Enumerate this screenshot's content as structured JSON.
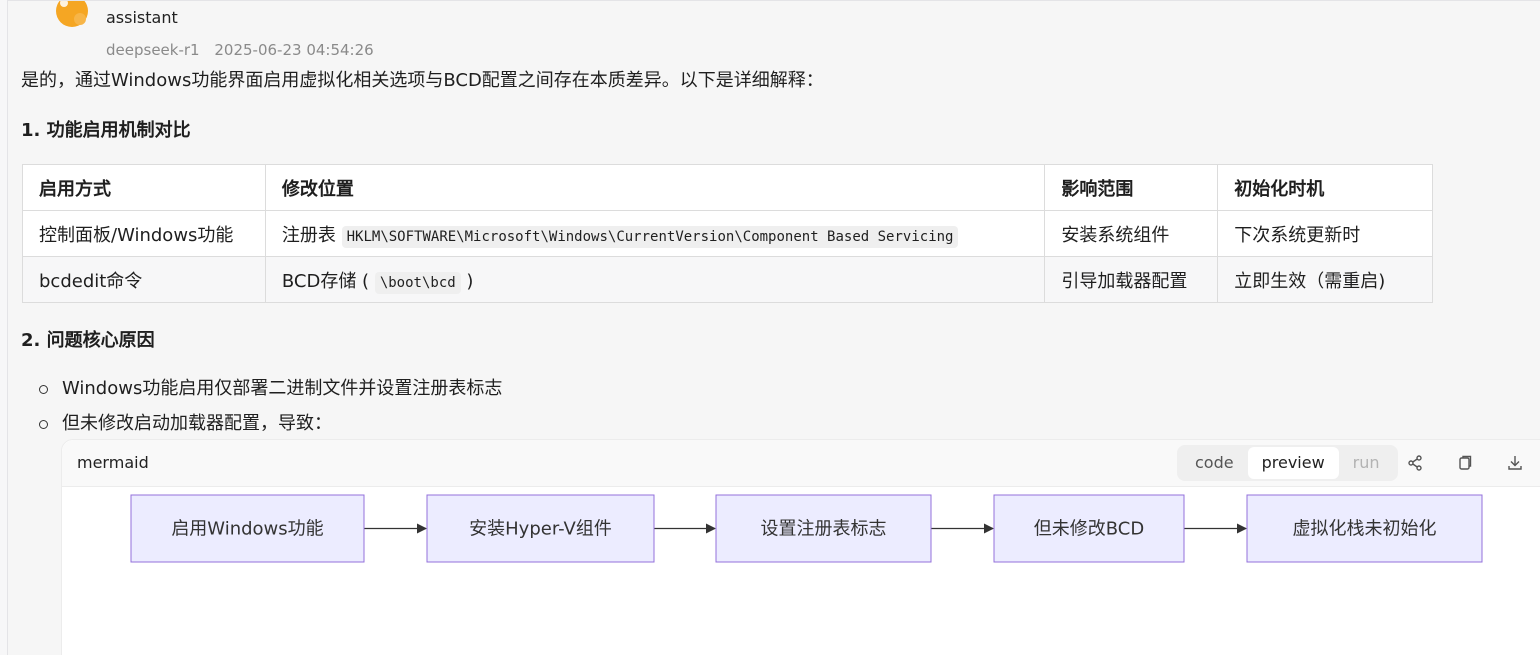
{
  "message": {
    "role": "assistant",
    "model": "deepseek-r1",
    "timestamp": "2025-06-23 04:54:26",
    "intro": "是的，通过Windows功能界面启用虚拟化相关选项与BCD配置之间存在本质差异。以下是详细解释："
  },
  "section1": {
    "heading": "1. 功能启用机制对比",
    "table": {
      "headers": [
        "启用方式",
        "修改位置",
        "影响范围",
        "初始化时机"
      ],
      "rows": [
        {
          "method": "控制面板/Windows功能",
          "location_prefix": "注册表",
          "location_code": "HKLM\\SOFTWARE\\Microsoft\\Windows\\CurrentVersion\\Component Based Servicing",
          "location_suffix": "",
          "scope": "安装系统组件",
          "timing": "下次系统更新时"
        },
        {
          "method": "bcdedit命令",
          "location_prefix": "BCD存储 (",
          "location_code": "\\boot\\bcd",
          "location_suffix": ")",
          "scope": "引导加载器配置",
          "timing": "立即生效（需重启)"
        }
      ]
    }
  },
  "section2": {
    "heading": "2. 问题核心原因",
    "bullets": [
      "Windows功能启用仅部署二进制文件并设置注册表标志",
      "但未修改启动加载器配置，导致："
    ]
  },
  "mermaid": {
    "title": "mermaid",
    "modes": [
      "code",
      "preview",
      "run"
    ],
    "active_mode": "preview",
    "icons": [
      "share-icon",
      "copy-icon",
      "download-icon"
    ],
    "nodes": [
      "启用Windows功能",
      "安装Hyper-V组件",
      "设置注册表标志",
      "但未修改BCD",
      "虚拟化栈未初始化"
    ],
    "node_fill": "#ececff",
    "node_stroke": "#9370db"
  }
}
